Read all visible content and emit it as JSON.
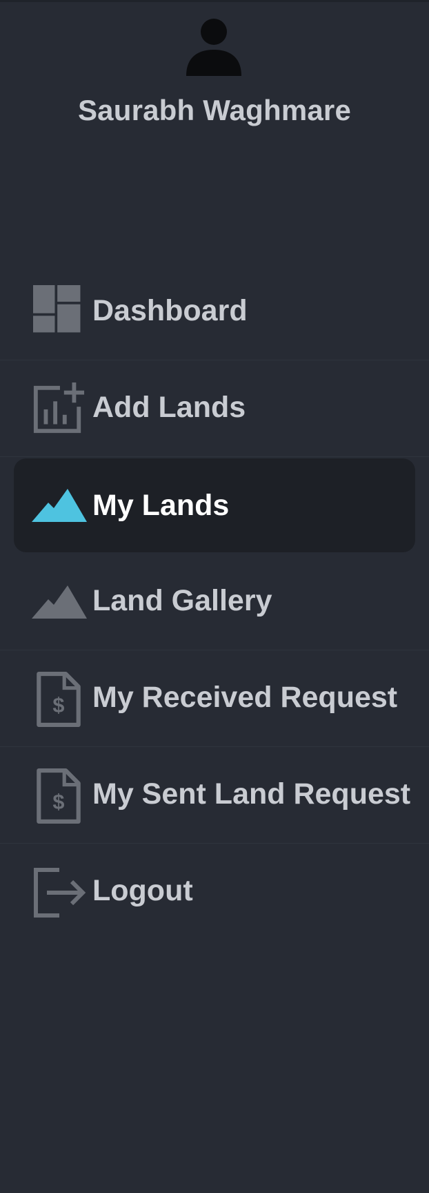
{
  "profile": {
    "name": "Saurabh Waghmare",
    "avatar_icon": "user-icon"
  },
  "nav": {
    "active_color": "#4ec3e0",
    "icon_color": "#6b6f77",
    "items": [
      {
        "label": "Dashboard",
        "icon": "dashboard-icon",
        "active": false
      },
      {
        "label": "Add Lands",
        "icon": "add-chart-icon",
        "active": false
      },
      {
        "label": "My Lands",
        "icon": "mountain-icon",
        "active": true
      },
      {
        "label": "Land Gallery",
        "icon": "mountain-icon",
        "active": false
      },
      {
        "label": "My Received Request",
        "icon": "dollar-document-icon",
        "active": false
      },
      {
        "label": "My Sent Land Request",
        "icon": "dollar-document-icon",
        "active": false
      },
      {
        "label": "Logout",
        "icon": "logout-icon",
        "active": false
      }
    ]
  }
}
